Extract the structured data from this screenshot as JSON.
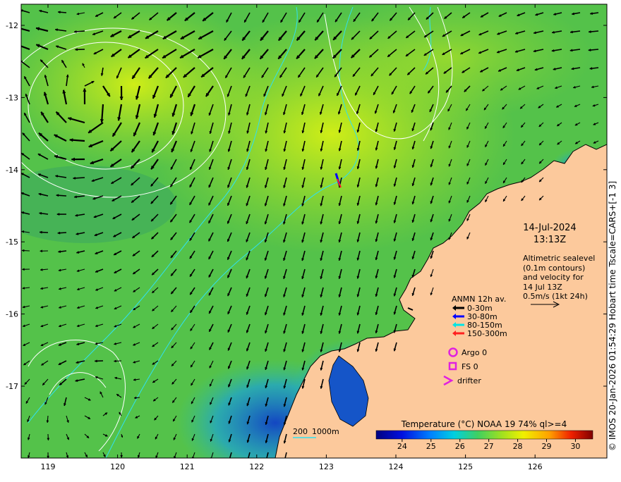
{
  "map": {
    "x_ticks": [
      "119",
      "120",
      "121",
      "122",
      "123",
      "124",
      "125",
      "126"
    ],
    "y_ticks": [
      "-12",
      "-13",
      "-14",
      "-15",
      "-16",
      "-17"
    ]
  },
  "date_line": "14-Jul-2024",
  "time_line": "13:13Z",
  "altimetry_note": {
    "line1": "Altimetric sealevel",
    "line2": "(0.1m contours)",
    "line3": "and velocity for",
    "line4": "14 Jul 13Z",
    "line5": "0.5m/s (1kt 24h)"
  },
  "anmn_legend": {
    "title": "ANMN 12h av.",
    "items": [
      {
        "label": "0-30m",
        "color": "#000000"
      },
      {
        "label": "30-80m",
        "color": "#0000ff"
      },
      {
        "label": "80-150m",
        "color": "#00e5e5"
      },
      {
        "label": "150-300m",
        "color": "#ff2020"
      }
    ]
  },
  "obs_legend": {
    "argo": "Argo 0",
    "fs": "FS 0",
    "drifter": "drifter",
    "marker_color": "#e020e0"
  },
  "depth_legend": {
    "label1": "200",
    "label2": "1000m",
    "color": "#30e0f0"
  },
  "colorbar": {
    "title": "Temperature (°C) NOAA 19 74% ql>=4",
    "ticks": [
      "24",
      "25",
      "26",
      "27",
      "28",
      "29",
      "30"
    ]
  },
  "credit": "© IMOS 20-Jan-2026 01:54:29 Hobart time Tscale=CARS+[-1 3]",
  "colors": {
    "land": "#fcc99c",
    "sst_dominant": "#54c24a",
    "sst_warm": "#c6ea1a",
    "sst_cool": "#1555c8",
    "velocity_arrows": "#000000",
    "contour": "#ffffff",
    "isobath": "#30e0f0"
  }
}
